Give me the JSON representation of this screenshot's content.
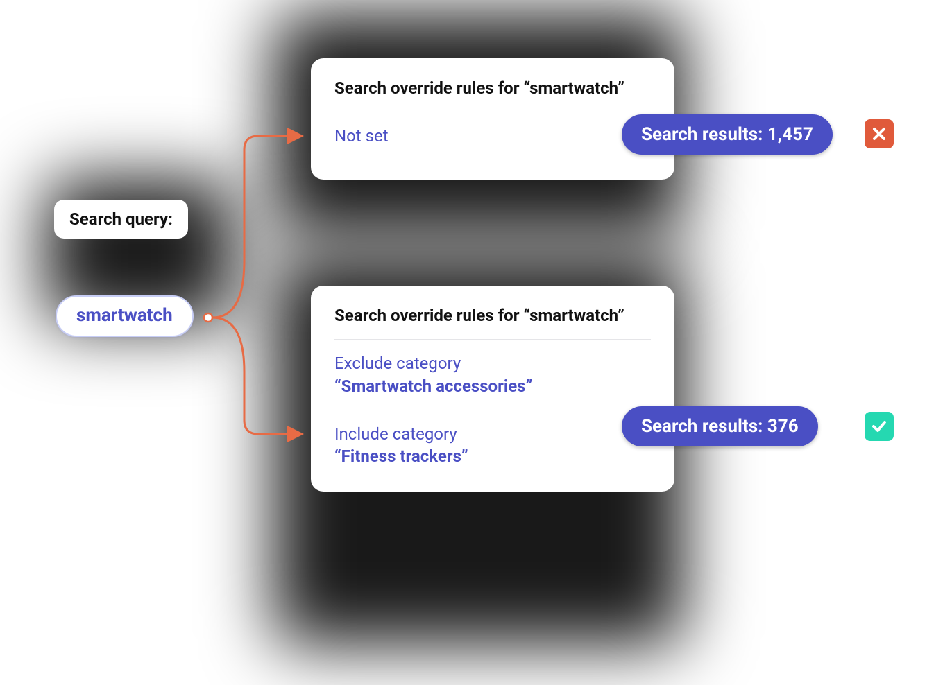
{
  "query": {
    "label": "Search query:",
    "value": "smartwatch"
  },
  "blocks": {
    "top": {
      "title": "Search override rules for “smartwatch”",
      "rule_notset": "Not set",
      "results_label": "Search results: 1,457"
    },
    "bottom": {
      "title": "Search override rules for “smartwatch”",
      "rule_exclude_prefix": "Exclude category",
      "rule_exclude_value": "“Smartwatch accessories”",
      "rule_include_prefix": "Include category",
      "rule_include_value": "“Fitness trackers”",
      "results_label": "Search results: 376"
    }
  }
}
